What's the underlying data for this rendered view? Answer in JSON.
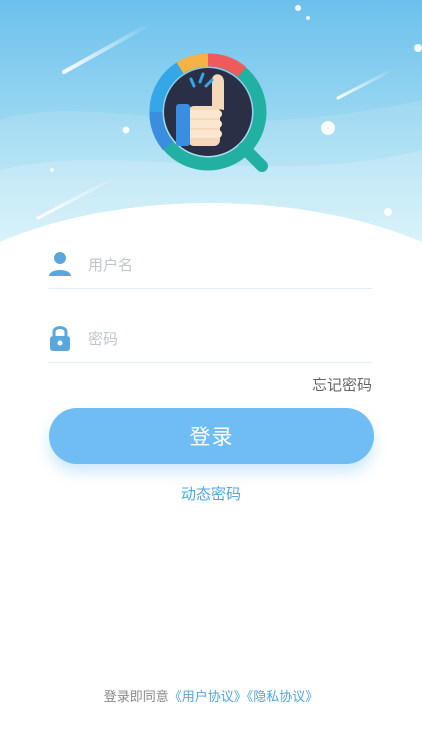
{
  "login": {
    "username_placeholder": "用户名",
    "password_placeholder": "密码",
    "forgot_password": "忘记密码",
    "login_button": "登录",
    "dynamic_password": "动态密码",
    "agreement_prefix": "登录即同意",
    "user_agreement": "《用户协议》",
    "privacy_agreement": "《隐私协议》"
  },
  "icons": {
    "logo": "thumbs-up-magnifier-logo",
    "username": "user-icon",
    "password": "lock-icon"
  },
  "colors": {
    "accent": "#70bdf4",
    "link": "#4ea6e3",
    "hero_top": "#6cc0ec",
    "hero_bottom": "#c5ecf7"
  }
}
